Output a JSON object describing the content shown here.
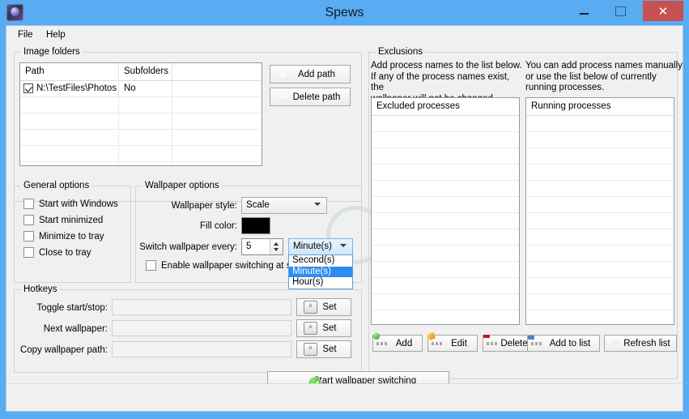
{
  "window": {
    "title": "Spews",
    "icon": "app-icon",
    "controls": {
      "minimize": "minimize",
      "maximize": "maximize",
      "close": "close"
    }
  },
  "menu": {
    "items": [
      {
        "label": "File"
      },
      {
        "label": "Help"
      }
    ]
  },
  "image_folders": {
    "title": "Image folders",
    "columns": [
      "Path",
      "Subfolders",
      ""
    ],
    "rows": [
      {
        "checked": true,
        "path": "N:\\TestFiles\\Photos",
        "subfolders": "No"
      }
    ],
    "empty_rows": 5,
    "buttons": [
      {
        "label": "Add path",
        "icon": "plus-circle-icon"
      },
      {
        "label": "Delete path",
        "icon": "minus-circle-icon"
      }
    ]
  },
  "general_options": {
    "title": "General options",
    "checkboxes": [
      {
        "label": "Start with Windows",
        "checked": false
      },
      {
        "label": "Start minimized",
        "checked": false
      },
      {
        "label": "Minimize to tray",
        "checked": false
      },
      {
        "label": "Close to tray",
        "checked": false
      }
    ]
  },
  "wallpaper_options": {
    "title": "Wallpaper options",
    "style_label": "Wallpaper style:",
    "style_value": "Scale",
    "fill_color_label": "Fill color:",
    "fill_color_value": "#000000",
    "switch_every_label": "Switch wallpaper every:",
    "switch_every_value": "5",
    "unit_value": "Minute(s)",
    "unit_options": [
      "Second(s)",
      "Minute(s)",
      "Hour(s)"
    ],
    "unit_selected_index": 1,
    "startup_checkbox": {
      "label": "Enable wallpaper switching at startup",
      "checked": false
    }
  },
  "hotkeys": {
    "title": "Hotkeys",
    "rows": [
      {
        "label": "Toggle start/stop:",
        "value": "",
        "button": "Set",
        "icon": "keyboard-key-icon"
      },
      {
        "label": "Next wallpaper:",
        "value": "",
        "button": "Set",
        "icon": "keyboard-key-icon"
      },
      {
        "label": "Copy wallpaper path:",
        "value": "",
        "button": "Set",
        "icon": "keyboard-key-icon"
      }
    ]
  },
  "exclusions": {
    "title": "Exclusions",
    "left_help": "Add process names to the list below.\nIf any of the process names exist, the\nwallpaper will not be changed.",
    "right_help": "You can add process names manually\nor use the list below of currently\nrunning processes.",
    "excluded_header": "Excluded processes",
    "running_header": "Running processes",
    "excluded_items": [],
    "running_items": [],
    "left_buttons": [
      {
        "label": "Add",
        "icon": "gear-add-icon"
      },
      {
        "label": "Edit",
        "icon": "gear-edit-icon"
      },
      {
        "label": "Delete",
        "icon": "gear-delete-icon"
      }
    ],
    "right_buttons": [
      {
        "label": "Add to list",
        "icon": "gear-arrow-icon"
      },
      {
        "label": "Refresh list",
        "icon": "refresh-icon"
      }
    ]
  },
  "start_button": {
    "label": "Start wallpaper switching",
    "icon": "green-check-icon"
  },
  "colors": {
    "titlebar": "#59abf2",
    "client": "#f0f0f0",
    "close_button": "#c75050",
    "selection": "#2d8cf0",
    "fill_swatch": "#000000"
  }
}
